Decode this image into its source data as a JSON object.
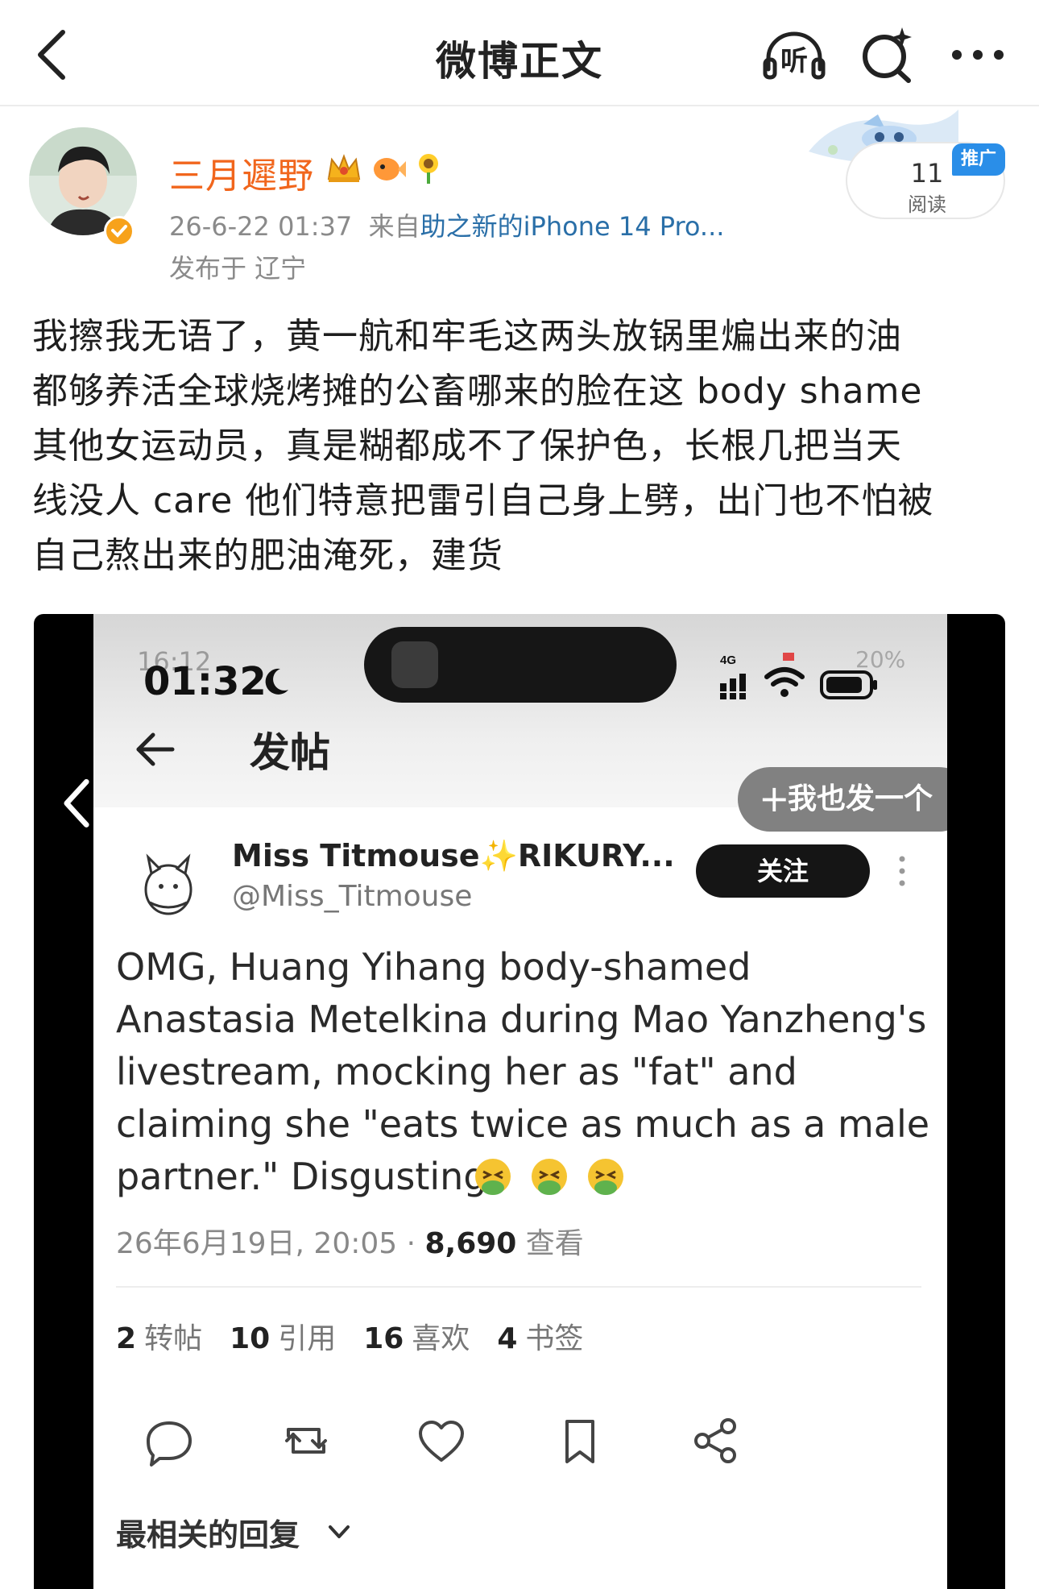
{
  "nav": {
    "title": "微博正文",
    "listen_label": "听"
  },
  "author": {
    "name": "三月遲野",
    "timestamp": "26-6-22 01:37",
    "source_prefix": "来自",
    "source": "助之新的iPhone 14 Pro...",
    "location": "发布于 辽宁"
  },
  "reads": {
    "count": "11",
    "label": "阅读",
    "promo": "推广"
  },
  "post": {
    "lines": [
      "我擦我无语了，黄一航和牢毛这两头放锅里煸出来的油",
      "都够养活全球烧烤摊的公畜哪来的脸在这 body shame",
      "其他女运动员，真是糊都成不了保护色，长根几把当天",
      "线没人 care 他们特意把雷引自己身上劈，出门也不怕被",
      "自己熬出来的肥油淹死，建货"
    ]
  },
  "screenshot": {
    "ghost_time": "16:12",
    "status_time": "01:32",
    "network": "4G",
    "ghost_battery": "20%",
    "header_title": "发帖",
    "post_one": "我也发一个",
    "tweet": {
      "display_name": "Miss Titmouse✨RIKURY...",
      "handle": "@Miss_Titmouse",
      "follow_label": "关注",
      "text_lines": [
        "OMG, Huang Yihang body-shamed",
        "Anastasia Metelkina during Mao Yanzheng's",
        "livestream, mocking her as \"fat\" and",
        "claiming she \"eats twice as much as a male",
        "partner.\" Disgusting"
      ],
      "datetime": "26年6月19日, 20:05 · ",
      "views": "8,690",
      "views_label": " 查看",
      "stats": [
        {
          "value": "2",
          "label": "转帖"
        },
        {
          "value": "10",
          "label": "引用"
        },
        {
          "value": "16",
          "label": "喜欢"
        },
        {
          "value": "4",
          "label": "书签"
        }
      ],
      "replies_label": "最相关的回复"
    }
  },
  "colors": {
    "author_name": "#f1661d",
    "source_link": "#2a6fa8",
    "promo": "#2a8ee8",
    "verified": "#f7a21b"
  },
  "icons": [
    "back-icon",
    "headphones-icon",
    "sparkle-search-icon",
    "more-icon",
    "crown-badge-icon",
    "fish-badge-icon",
    "sunflower-badge-icon",
    "moon-icon",
    "signal-icon",
    "wifi-icon",
    "battery-icon",
    "reply-icon",
    "retweet-icon",
    "like-icon",
    "bookmark-icon",
    "share-icon",
    "chevron-down-icon"
  ]
}
